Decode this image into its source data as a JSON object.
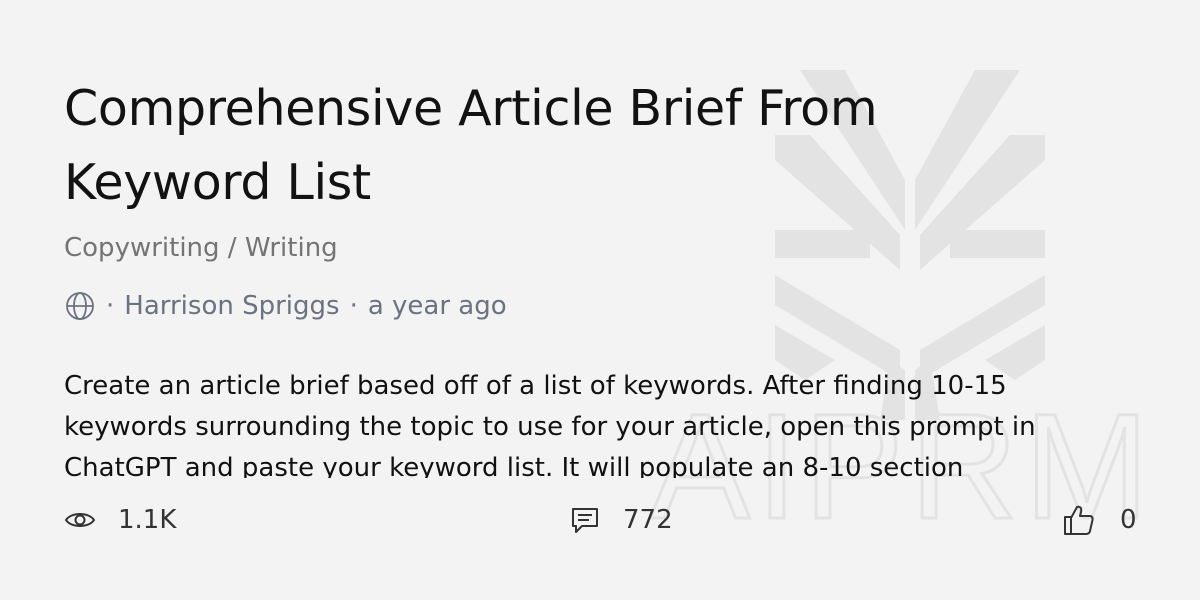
{
  "card": {
    "title": "Comprehensive Article Brief From Keyword List",
    "category": "Copywriting / Writing",
    "author": "Harrison Spriggs",
    "separator": "·",
    "time_ago": "a year ago",
    "description": "Create an article brief based off of a list of keywords. After finding 10-15 keywords surrounding the topic to use for your article, open this prompt in ChatGPT and paste your keyword list. It will populate an 8-10 section"
  },
  "stats": {
    "views": "1.1K",
    "comments": "772",
    "likes": "0"
  },
  "watermark": {
    "text": "AIPRM"
  },
  "icons": {
    "visibility": "globe-icon",
    "views": "eye-icon",
    "comments": "comment-icon",
    "likes": "thumbs-up-icon"
  },
  "colors": {
    "background": "#f3f3f3",
    "title": "#121212",
    "muted": "#747474",
    "meta": "#6b7280",
    "watermark": "#e2e2e2"
  }
}
